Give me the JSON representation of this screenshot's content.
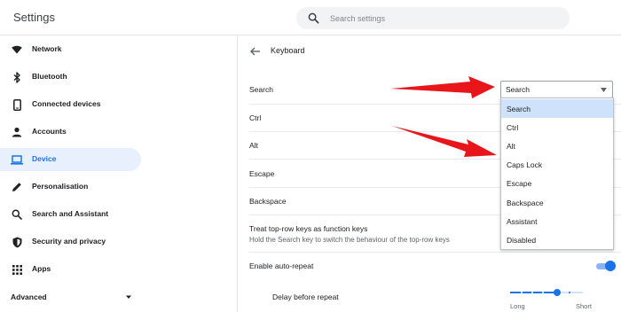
{
  "header": {
    "title": "Settings",
    "search_placeholder": "Search settings"
  },
  "sidebar": {
    "items": [
      {
        "label": "Network",
        "icon": "wifi-icon"
      },
      {
        "label": "Bluetooth",
        "icon": "bluetooth-icon"
      },
      {
        "label": "Connected devices",
        "icon": "phone-icon"
      },
      {
        "label": "Accounts",
        "icon": "person-icon"
      },
      {
        "label": "Device",
        "icon": "laptop-icon",
        "active": true
      },
      {
        "label": "Personalisation",
        "icon": "pencil-icon"
      },
      {
        "label": "Search and Assistant",
        "icon": "search-icon"
      },
      {
        "label": "Security and privacy",
        "icon": "shield-icon"
      },
      {
        "label": "Apps",
        "icon": "grid-icon"
      }
    ],
    "advanced_label": "Advanced"
  },
  "main": {
    "page_title": "Keyboard",
    "rows": [
      {
        "label": "Search"
      },
      {
        "label": "Ctrl"
      },
      {
        "label": "Alt"
      },
      {
        "label": "Escape"
      },
      {
        "label": "Backspace"
      }
    ],
    "function_keys": {
      "label": "Treat top-row keys as function keys",
      "description": "Hold the Search key to switch the behaviour of the top-row keys"
    },
    "auto_repeat": {
      "label": "Enable auto-repeat",
      "enabled": true
    },
    "delay": {
      "label": "Delay before repeat",
      "min_label": "Long",
      "max_label": "Short",
      "value_fraction": 0.65
    },
    "search_select": {
      "value": "Search",
      "options": [
        "Search",
        "Ctrl",
        "Alt",
        "Caps Lock",
        "Escape",
        "Backspace",
        "Assistant",
        "Disabled"
      ],
      "highlighted": "Search"
    }
  },
  "colors": {
    "accent": "#1a73e8",
    "active_bg": "#e8f0fe",
    "highlight": "#cfe2fb",
    "arrow": "#e8161b"
  }
}
